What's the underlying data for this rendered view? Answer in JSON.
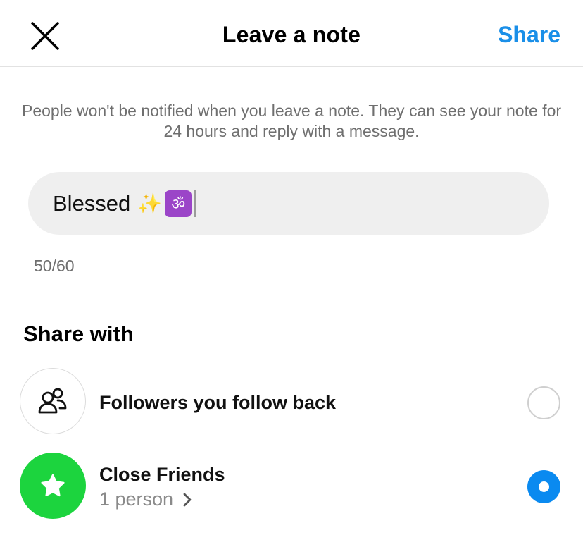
{
  "header": {
    "close_icon": "close-icon",
    "title": "Leave a note",
    "share_label": "Share",
    "share_color": "#1a8fe8"
  },
  "info_text": "People won't be notified when you leave a note. They can see your note for 24 hours and reply with a message.",
  "note": {
    "text": "Blessed",
    "emojis": [
      "sparkles",
      "om-symbol"
    ],
    "sparkles_glyph": "✨",
    "om_glyph": "ॐ",
    "counter": "50/60"
  },
  "share_with": {
    "title": "Share with",
    "options": [
      {
        "label": "Followers you follow back",
        "icon": "people-icon",
        "selected": false
      },
      {
        "label": "Close Friends",
        "sublabel": "1 person",
        "icon": "star-icon",
        "icon_bg": "#1cd43e",
        "selected": true,
        "selected_color": "#0a8af0"
      }
    ]
  }
}
